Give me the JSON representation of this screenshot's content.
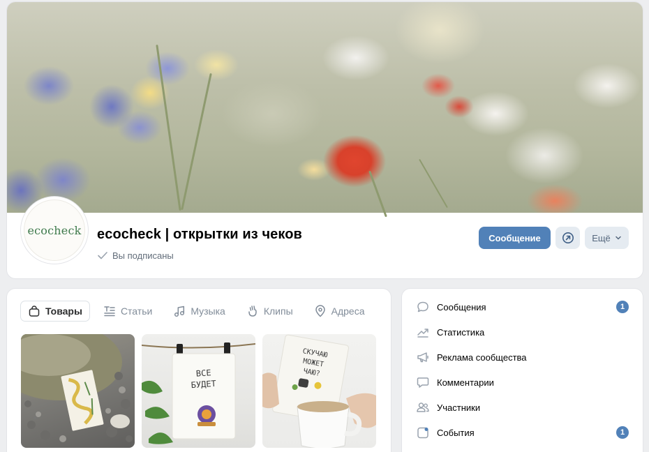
{
  "group": {
    "avatar_text": "ecocheck",
    "title": "ecocheck | открытки из чеков",
    "subscribed_label": "Вы подписаны"
  },
  "actions": {
    "message_label": "Сообщение",
    "more_label": "Ещё"
  },
  "tabs": [
    {
      "label": "Товары",
      "icon": "bag-icon",
      "active": true
    },
    {
      "label": "Статьи",
      "icon": "article-icon",
      "active": false
    },
    {
      "label": "Музыка",
      "icon": "music-note-icon",
      "active": false
    },
    {
      "label": "Клипы",
      "icon": "clips-icon",
      "active": false
    },
    {
      "label": "Адреса",
      "icon": "location-pin-icon",
      "active": false
    }
  ],
  "products": [
    {
      "card_text": ""
    },
    {
      "card_text": "ВСЕ БУДЕТ"
    },
    {
      "card_text": "СКУЧАЮ МОЖЕТ ЧАЮ?"
    }
  ],
  "menu": [
    {
      "label": "Сообщения",
      "icon": "chat-bubble-icon",
      "badge": "1"
    },
    {
      "label": "Статистика",
      "icon": "trend-chart-icon",
      "badge": ""
    },
    {
      "label": "Реклама сообщества",
      "icon": "megaphone-icon",
      "badge": ""
    },
    {
      "label": "Комментарии",
      "icon": "comment-icon",
      "badge": ""
    },
    {
      "label": "Участники",
      "icon": "users-icon",
      "badge": ""
    },
    {
      "label": "События",
      "icon": "event-icon",
      "badge": "1"
    }
  ],
  "colors": {
    "accent": "#5181b8",
    "secondary_button": "#e5ebf1",
    "muted_text": "#818c99",
    "background": "#edeef0"
  }
}
